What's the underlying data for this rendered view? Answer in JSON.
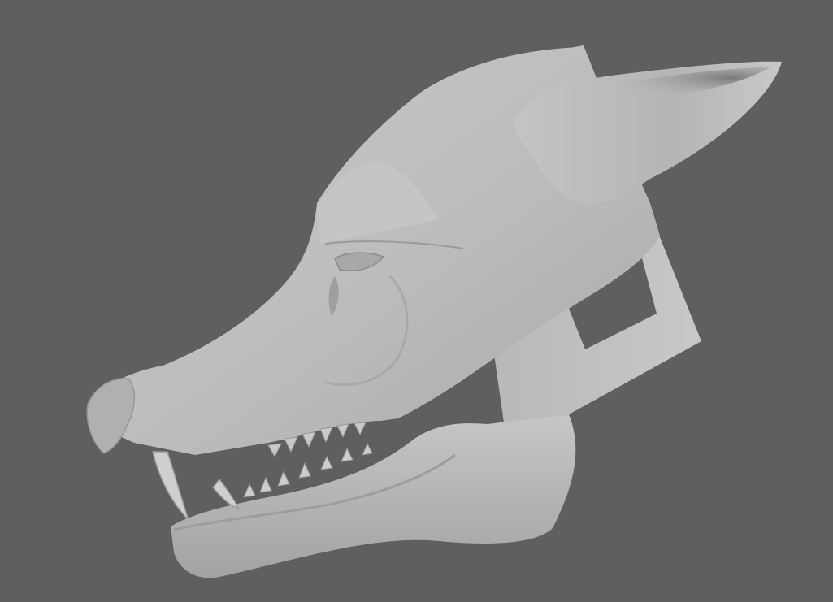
{
  "viewport": {
    "background_color": "#5f5f5f",
    "model_base_color": "#bdbdbd",
    "model_shadow_color": "#8a8a8a",
    "model_highlight_color": "#d8d8d8"
  }
}
